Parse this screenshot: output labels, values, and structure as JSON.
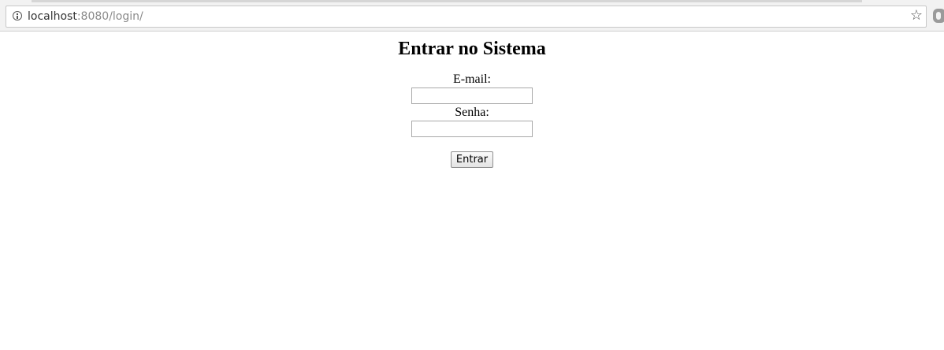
{
  "browser": {
    "url_host": "localhost",
    "url_rest": ":8080/login/",
    "info_icon": "info-icon",
    "star_icon": "star-icon",
    "extension_icon": "extension-icon"
  },
  "page": {
    "title": "Entrar no Sistema",
    "form": {
      "email_label": "E-mail:",
      "email_value": "",
      "password_label": "Senha:",
      "password_value": "",
      "submit_label": "Entrar"
    }
  }
}
